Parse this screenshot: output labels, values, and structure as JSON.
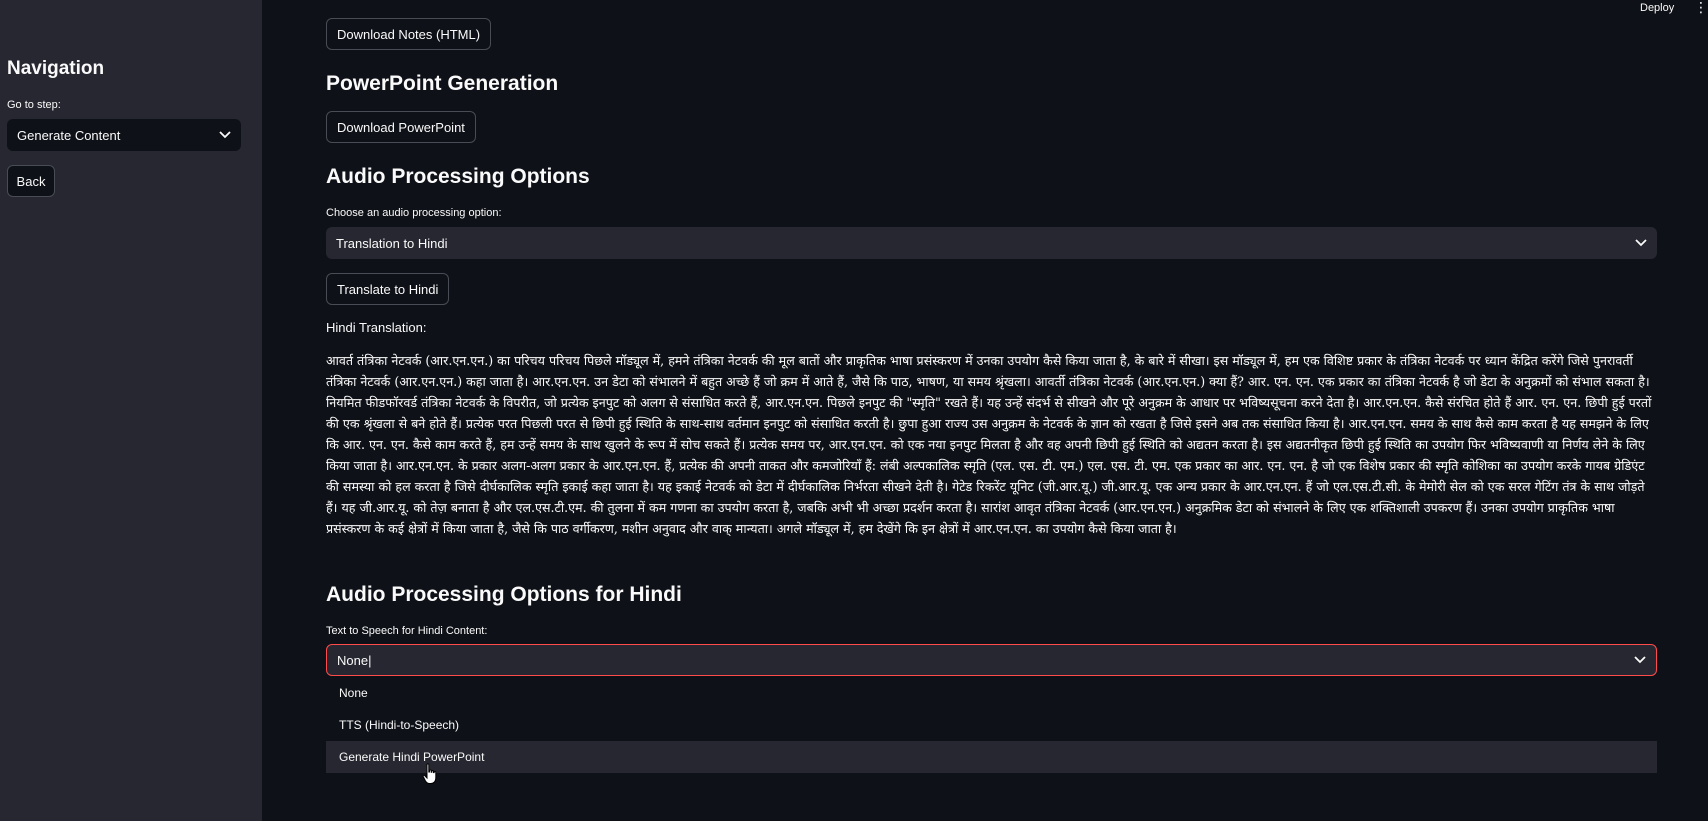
{
  "sidebar": {
    "title": "Navigation",
    "goto_label": "Go to step:",
    "step_select_value": "Generate Content",
    "back_label": "Back"
  },
  "topbar": {
    "deploy_label": "Deploy",
    "menu_icon": "kebab-menu-icon"
  },
  "main": {
    "download_notes_label": "Download Notes (HTML)",
    "ppt_heading": "PowerPoint Generation",
    "download_ppt_label": "Download PowerPoint",
    "audio_heading": "Audio Processing Options",
    "audio_option_label": "Choose an audio processing option:",
    "audio_option_value": "Translation to Hindi",
    "translate_button_label": "Translate to Hindi",
    "hindi_translation_label": "Hindi Translation:",
    "hindi_translation_text": "आवर्त तंत्रिका नेटवर्क (आर.एन.एन.) का परिचय परिचय पिछले मॉड्यूल में, हमने तंत्रिका नेटवर्क की मूल बातों और प्राकृतिक भाषा प्रसंस्करण में उनका उपयोग कैसे किया जाता है, के बारे में सीखा। इस मॉड्यूल में, हम एक विशिष्ट प्रकार के तंत्रिका नेटवर्क पर ध्यान केंद्रित करेंगे जिसे पुनरावर्ती तंत्रिका नेटवर्क (आर.एन.एन.) कहा जाता है। आर.एन.एन. उन डेटा को संभालने में बहुत अच्छे हैं जो क्रम में आते हैं, जैसे कि पाठ, भाषण, या समय श्रृंखला। आवर्ती तंत्रिका नेटवर्क (आर.एन.एन.) क्या हैं? आर. एन. एन. एक प्रकार का तंत्रिका नेटवर्क है जो डेटा के अनुक्रमों को संभाल सकता है। नियमित फीडफॉरवर्ड तंत्रिका नेटवर्क के विपरीत, जो प्रत्येक इनपुट को अलग से संसाधित करते हैं, आर.एन.एन. पिछले इनपुट की \"स्मृति\" रखते हैं। यह उन्हें संदर्भ से सीखने और पूरे अनुक्रम के आधार पर भविष्यसूचना करने देता है। आर.एन.एन. कैसे संरचित होते हैं आर. एन. एन. छिपी हुई परतों की एक श्रृंखला से बने होते हैं। प्रत्येक परत पिछली परत से छिपी हुई स्थिति के साथ-साथ वर्तमान इनपुट को संसाधित करती है। छुपा हुआ राज्य उस अनुक्रम के नेटवर्क के ज्ञान को रखता है जिसे इसने अब तक संसाधित किया है। आर.एन.एन. समय के साथ कैसे काम करता है यह समझने के लिए कि आर. एन. एन. कैसे काम करते हैं, हम उन्हें समय के साथ खुलने के रूप में सोच सकते हैं। प्रत्येक समय पर, आर.एन.एन. को एक नया इनपुट मिलता है और वह अपनी छिपी हुई स्थिति को अद्यतन करता है। इस अद्यतनीकृत छिपी हुई स्थिति का उपयोग फिर भविष्यवाणी या निर्णय लेने के लिए किया जाता है। आर.एन.एन. के प्रकार अलग-अलग प्रकार के आर.एन.एन. हैं, प्रत्येक की अपनी ताकत और कमजोरियाँ हैं: लंबी अल्पकालिक स्मृति (एल. एस. टी. एम.) एल. एस. टी. एम. एक प्रकार का आर. एन. एन. है जो एक विशेष प्रकार की स्मृति कोशिका का उपयोग करके गायब ग्रेडिएंट की समस्या को हल करता है जिसे दीर्घकालिक स्मृति इकाई कहा जाता है। यह इकाई नेटवर्क को डेटा में दीर्घकालिक निर्भरता सीखने देती है। गेटेड रिकरेंट यूनिट (जी.आर.यू.) जी.आर.यू. एक अन्य प्रकार के आर.एन.एन. हैं जो एल.एस.टी.सी. के मेमोरी सेल को एक सरल गेटिंग तंत्र के साथ जोड़ते हैं। यह जी.आर.यू. को तेज़ बनाता है और एल.एस.टी.एम. की तुलना में कम गणना का उपयोग करता है, जबकि अभी भी अच्छा प्रदर्शन करता है। सारांश आवृत तंत्रिका नेटवर्क (आर.एन.एन.) अनुक्रमिक डेटा को संभालने के लिए एक शक्तिशाली उपकरण हैं। उनका उपयोग प्राकृतिक भाषा प्रसंस्करण के कई क्षेत्रों में किया जाता है, जैसे कि पाठ वर्गीकरण, मशीन अनुवाद और वाक् मान्यता। अगले मॉड्यूल में, हम देखेंगे कि इन क्षेत्रों में आर.एन.एन. का उपयोग कैसे किया जाता है।",
    "hindi_audio_heading": "Audio Processing Options for Hindi",
    "tts_label": "Text to Speech for Hindi Content:",
    "tts_value": "None",
    "tts_options": [
      "None",
      "TTS (Hindi-to-Speech)",
      "Generate Hindi PowerPoint"
    ]
  },
  "colors": {
    "background": "#0e1117",
    "sidebar": "#262730",
    "focus_border": "#ff4b4b"
  }
}
